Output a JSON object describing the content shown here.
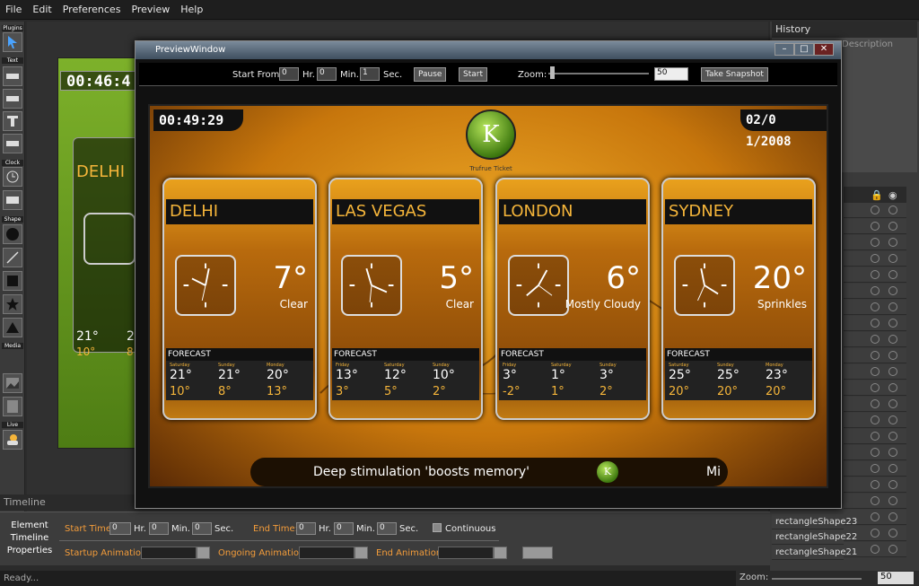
{
  "menu": [
    "File",
    "Edit",
    "Preferences",
    "Preview",
    "Help"
  ],
  "left_tools": {
    "sections": [
      "Plugins",
      "Text",
      "Clock",
      "Shape",
      "Media",
      "Live"
    ]
  },
  "history": {
    "title": "History",
    "column": "Description"
  },
  "layers_named": [
    "rectangleShape23",
    "rectangleShape22",
    "rectangleShape21"
  ],
  "timeline": {
    "title": "Timeline"
  },
  "props": {
    "box_label": "Element\nTimeline\nProperties",
    "start_time": "Start Time:",
    "end_time": "End Time:",
    "hr": "Hr.",
    "min": "Min.",
    "sec": "Sec.",
    "zero": "0",
    "continuous": "Continuous",
    "startup": "Startup Animation:",
    "ongoing": "Ongoing Animation:",
    "end": "End Animation:"
  },
  "status": {
    "text": "Ready...",
    "zoom_label": "Zoom:",
    "zoom_value": "50"
  },
  "preview": {
    "title": "PreviewWindow",
    "start_from": "Start From:",
    "hr": "Hr.",
    "min": "Min.",
    "sec": "Sec.",
    "start_hr": "0",
    "start_min": "0",
    "start_sec": "1",
    "pause": "Pause",
    "start": "Start",
    "zoom": "Zoom:",
    "zoom_value": "50",
    "snapshot": "Take Snapshot"
  },
  "scene": {
    "clock": "00:49:29",
    "date": "02/0 1/2008",
    "logo_letter": "K",
    "logo_caption": "Trufrue Ticket",
    "ticker_text": "Deep stimulation 'boosts memory'",
    "ticker_right": "Mi",
    "forecast_label": "FORECAST",
    "cards": [
      {
        "city": "DELHI",
        "temp": "7°",
        "cond": "Clear",
        "days": [
          "Saturday",
          "Sunday",
          "Monday"
        ],
        "hi": [
          "21°",
          "21°",
          "20°"
        ],
        "lo": [
          "10°",
          "8°",
          "13°"
        ]
      },
      {
        "city": "LAS VEGAS",
        "temp": "5°",
        "cond": "Clear",
        "days": [
          "Friday",
          "Saturday",
          "Sunday"
        ],
        "hi": [
          "13°",
          "12°",
          "10°"
        ],
        "lo": [
          "3°",
          "5°",
          "2°"
        ]
      },
      {
        "city": "LONDON",
        "temp": "6°",
        "cond": "Mostly Cloudy",
        "days": [
          "Friday",
          "Saturday",
          "Sunday"
        ],
        "hi": [
          "3°",
          "1°",
          "3°"
        ],
        "lo": [
          "-2°",
          "1°",
          "2°"
        ]
      },
      {
        "city": "SYDNEY",
        "temp": "20°",
        "cond": "Sprinkles",
        "days": [
          "Saturday",
          "Sunday",
          "Monday"
        ],
        "hi": [
          "25°",
          "25°",
          "23°"
        ],
        "lo": [
          "20°",
          "20°",
          "20°"
        ]
      }
    ]
  },
  "bg_comp": {
    "clock": "00:46:4",
    "city": "DELHI",
    "hi": "21°",
    "lo": "10°",
    "hi2": "2",
    "lo2": "8"
  }
}
